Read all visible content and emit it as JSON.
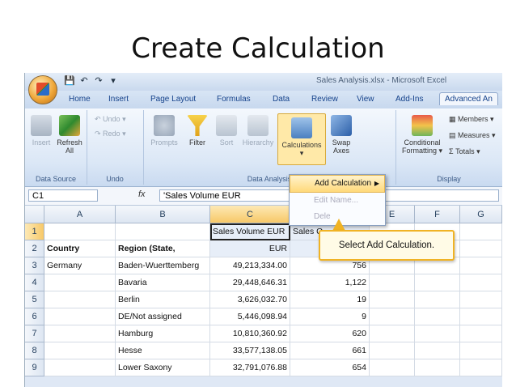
{
  "slide": {
    "title": "Create Calculation"
  },
  "window": {
    "title": "Sales Analysis.xlsx - Microsoft Excel"
  },
  "qat": {
    "save": "💾",
    "undo": "↶",
    "redo": "↷",
    "more": "▾"
  },
  "tabs": [
    "Home",
    "Insert",
    "Page Layout",
    "Formulas",
    "Data",
    "Review",
    "View",
    "Add-Ins",
    "Advanced An"
  ],
  "ribbon": {
    "data_source": {
      "label": "Data Source",
      "insert": "Insert",
      "refresh": "Refresh",
      "refresh_sub": "All"
    },
    "undo": {
      "label": "Undo",
      "undo": "Undo",
      "redo": "Redo"
    },
    "analysis": {
      "label": "Data Analysis",
      "prompts": "Prompts",
      "filter": "Filter",
      "sort": "Sort",
      "hierarchy": "Hierarchy",
      "calculations": "Calculations",
      "swap": "Swap",
      "swap_sub": "Axes"
    },
    "display": {
      "label": "Display",
      "conditional": "Conditional",
      "formatting": "Formatting",
      "members": "Members",
      "measures": "Measures",
      "totals": "Totals"
    }
  },
  "formula_bar": {
    "name_box": "C1",
    "fx": "fx",
    "value": "'Sales Volume EUR"
  },
  "columns": [
    "A",
    "B",
    "C",
    "D",
    "E",
    "F",
    "G"
  ],
  "rows": [
    {
      "n": "1",
      "a": "",
      "b": "",
      "c": "Sales Volume EUR",
      "d": "Sales Q"
    },
    {
      "n": "2",
      "a": "Country",
      "b": "Region (State,",
      "c": "EUR",
      "d": ""
    },
    {
      "n": "3",
      "a": "Germany",
      "b": "Baden-Wuerttemberg",
      "c": "49,213,334.00",
      "d": "756"
    },
    {
      "n": "4",
      "a": "",
      "b": "Bavaria",
      "c": "29,448,646.31",
      "d": "1,122"
    },
    {
      "n": "5",
      "a": "",
      "b": "Berlin",
      "c": "3,626,032.70",
      "d": "19"
    },
    {
      "n": "6",
      "a": "",
      "b": "DE/Not assigned",
      "c": "5,446,098.94",
      "d": "9"
    },
    {
      "n": "7",
      "a": "",
      "b": "Hamburg",
      "c": "10,810,360.92",
      "d": "620"
    },
    {
      "n": "8",
      "a": "",
      "b": "Hesse",
      "c": "33,577,138.05",
      "d": "661"
    },
    {
      "n": "9",
      "a": "",
      "b": "Lower Saxony",
      "c": "32,791,076.88",
      "d": "654"
    }
  ],
  "menu": {
    "add": "Add Calculation",
    "edit": "Edit Name...",
    "delete": "Dele"
  },
  "callout": {
    "text": "Select Add Calculation."
  },
  "colors": {
    "accent": "#f0b324",
    "tab_text": "#15428b"
  }
}
